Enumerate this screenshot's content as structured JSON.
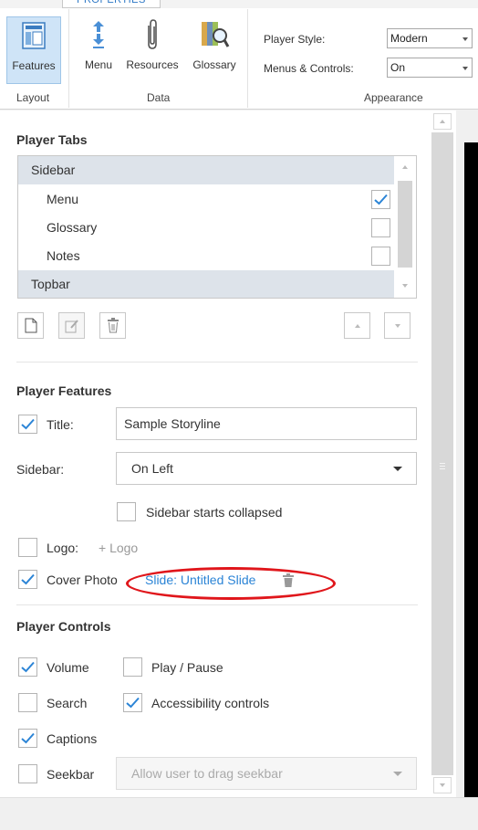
{
  "ribbon": {
    "tab_label": "PROPERTIES",
    "buttons": {
      "features": "Features",
      "menu": "Menu",
      "resources": "Resources",
      "glossary": "Glossary"
    },
    "groups": {
      "layout": "Layout",
      "data": "Data",
      "appearance": "Appearance"
    },
    "player_style_label": "Player Style:",
    "player_style_value": "Modern",
    "menus_controls_label": "Menus & Controls:",
    "menus_controls_value": "On"
  },
  "player_tabs": {
    "title": "Player Tabs",
    "items": [
      {
        "label": "Sidebar",
        "kind": "group"
      },
      {
        "label": "Menu",
        "kind": "child",
        "checked": true
      },
      {
        "label": "Glossary",
        "kind": "child",
        "checked": false
      },
      {
        "label": "Notes",
        "kind": "child",
        "checked": false
      },
      {
        "label": "Topbar",
        "kind": "group"
      }
    ]
  },
  "player_features": {
    "title": "Player Features",
    "title_label": "Title:",
    "title_checked": true,
    "title_value": "Sample Storyline",
    "sidebar_label": "Sidebar:",
    "sidebar_value": "On Left",
    "sidebar_collapsed_label": "Sidebar starts collapsed",
    "logo_label": "Logo:",
    "logo_add": "+ Logo",
    "cover_photo_label": "Cover Photo",
    "cover_photo_value": "Slide: Untitled Slide"
  },
  "player_controls": {
    "title": "Player Controls",
    "volume": "Volume",
    "play_pause": "Play / Pause",
    "search": "Search",
    "accessibility": "Accessibility controls",
    "captions": "Captions",
    "seekbar": "Seekbar",
    "seekbar_option": "Allow user to drag seekbar"
  },
  "colors": {
    "accent": "#2b84d6",
    "highlight_annotation": "#e0161b",
    "active_button_bg": "#cfe4f7"
  }
}
